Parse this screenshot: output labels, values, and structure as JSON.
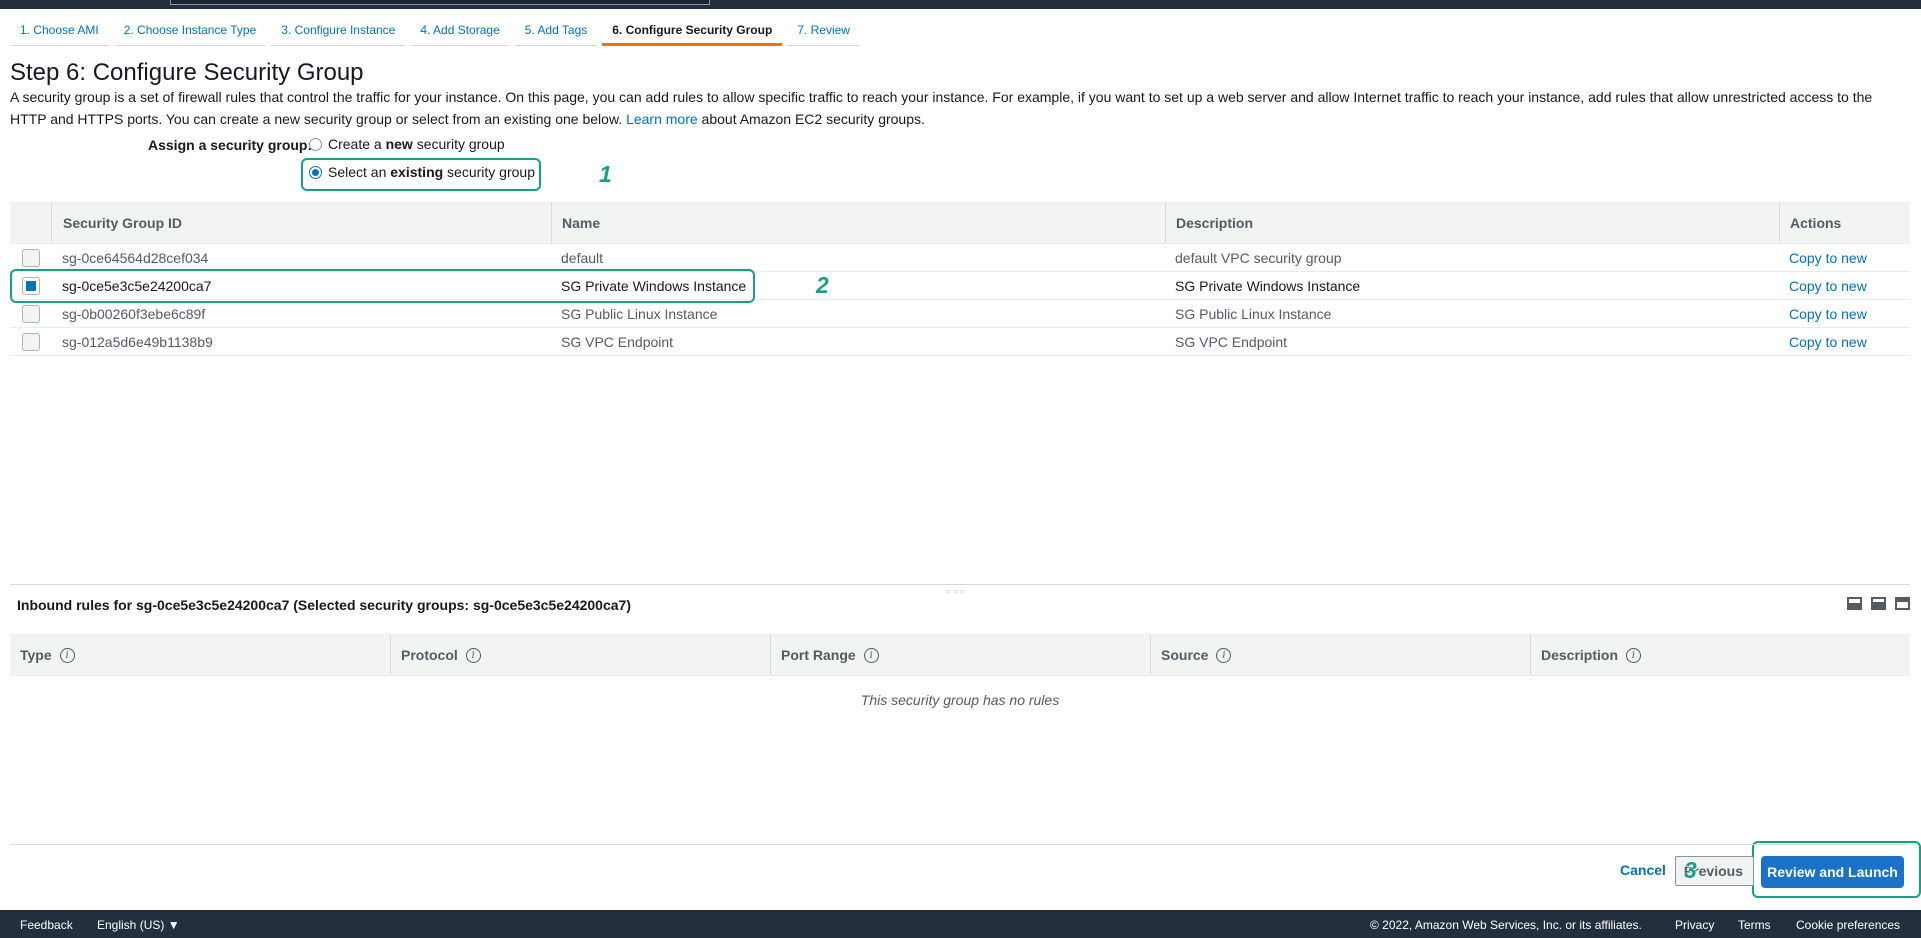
{
  "tabs": [
    {
      "label": "1. Choose AMI"
    },
    {
      "label": "2. Choose Instance Type"
    },
    {
      "label": "3. Configure Instance"
    },
    {
      "label": "4. Add Storage"
    },
    {
      "label": "5. Add Tags"
    },
    {
      "label": "6. Configure Security Group",
      "active": true
    },
    {
      "label": "7. Review"
    }
  ],
  "page": {
    "title": "Step 6: Configure Security Group",
    "intro_text": "A security group is a set of firewall rules that control the traffic for your instance. On this page, you can add rules to allow specific traffic to reach your instance. For example, if you want to set up a web server and allow Internet traffic to reach your instance, add rules that allow unrestricted access to the HTTP and HTTPS ports. You can create a new security group or select from an existing one below.",
    "learn_more": "Learn more",
    "intro_suffix": "about Amazon EC2 security groups."
  },
  "assign": {
    "label": "Assign a security group:",
    "option_new_prefix": "Create a ",
    "option_new_bold": "new",
    "option_new_suffix": " security group",
    "option_existing_prefix": "Select an ",
    "option_existing_bold": "existing",
    "option_existing_suffix": " security group",
    "selected": "existing"
  },
  "annotations": {
    "n1": "1",
    "n2": "2",
    "n3": "3"
  },
  "sg_table": {
    "headers": {
      "id": "Security Group ID",
      "name": "Name",
      "description": "Description",
      "actions": "Actions"
    },
    "rows": [
      {
        "id": "sg-0ce64564d28cef034",
        "name": "default",
        "description": "default VPC security group",
        "action": "Copy to new",
        "selected": false
      },
      {
        "id": "sg-0ce5e3c5e24200ca7",
        "name": "SG Private Windows Instance",
        "description": "SG Private Windows Instance",
        "action": "Copy to new",
        "selected": true
      },
      {
        "id": "sg-0b00260f3ebe6c89f",
        "name": "SG Public Linux Instance",
        "description": "SG Public Linux Instance",
        "action": "Copy to new",
        "selected": false
      },
      {
        "id": "sg-012a5d6e49b1138b9",
        "name": "SG VPC Endpoint",
        "description": "SG VPC Endpoint",
        "action": "Copy to new",
        "selected": false
      }
    ]
  },
  "inbound": {
    "title": "Inbound rules for sg-0ce5e3c5e24200ca7 (Selected security groups: sg-0ce5e3c5e24200ca7)",
    "headers": {
      "type": "Type",
      "protocol": "Protocol",
      "port_range": "Port Range",
      "source": "Source",
      "description": "Description"
    },
    "empty_message": "This security group has no rules"
  },
  "buttons": {
    "cancel": "Cancel",
    "previous": "Previous",
    "review_launch": "Review and Launch"
  },
  "footer": {
    "feedback": "Feedback",
    "language": "English (US) ▼",
    "copyright": "© 2022, Amazon Web Services, Inc. or its affiliates.",
    "privacy": "Privacy",
    "terms": "Terms",
    "cookies": "Cookie preferences"
  },
  "colors": {
    "accent": "#0073bb",
    "active_tab": "#ec7211",
    "annotation": "#16a085",
    "nav_bar": "#232f3e",
    "primary_button": "#1a72c9"
  }
}
